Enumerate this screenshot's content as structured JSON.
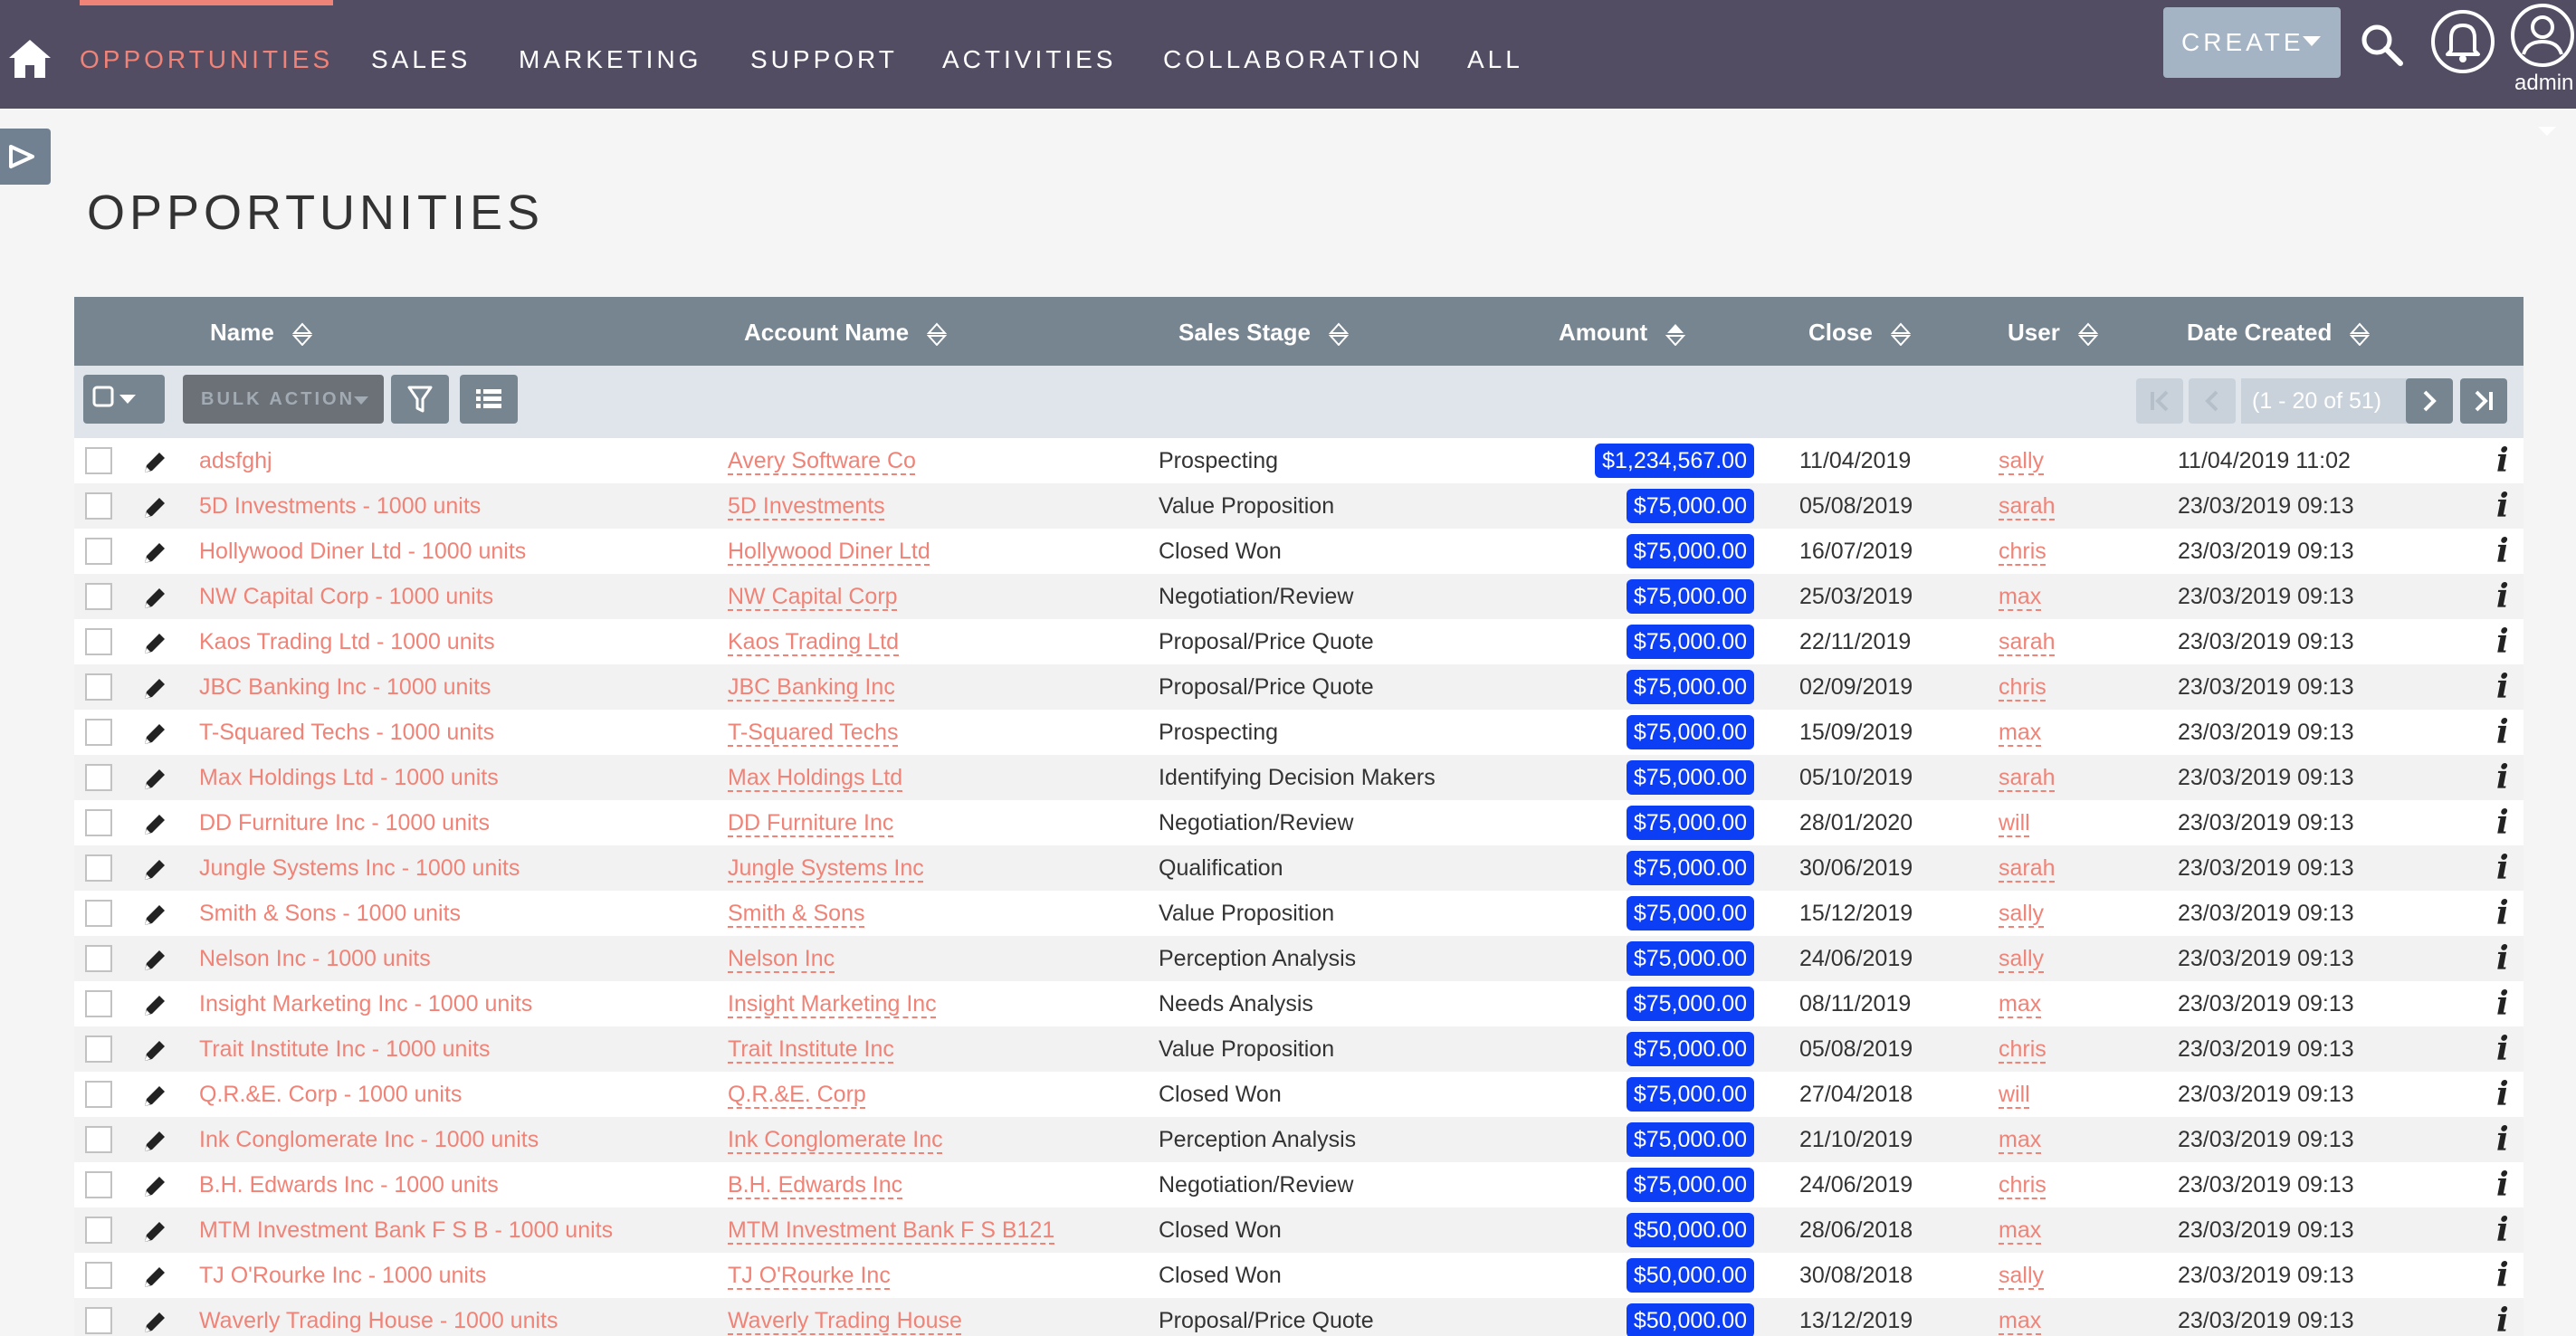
{
  "nav": {
    "tabs": [
      {
        "label": "OPPORTUNITIES",
        "active": true
      },
      {
        "label": "SALES",
        "active": false
      },
      {
        "label": "MARKETING",
        "active": false
      },
      {
        "label": "SUPPORT",
        "active": false
      },
      {
        "label": "ACTIVITIES",
        "active": false
      },
      {
        "label": "COLLABORATION",
        "active": false
      },
      {
        "label": "ALL",
        "active": false
      }
    ],
    "create_label": "CREATE",
    "user_label": "admin"
  },
  "page": {
    "title": "OPPORTUNITIES"
  },
  "table": {
    "columns": [
      "Name",
      "Account Name",
      "Sales Stage",
      "Amount",
      "Close",
      "User",
      "Date Created"
    ],
    "sorted_column": "Amount",
    "bulk_action_label": "BULK ACTION",
    "pagination_label": "(1 - 20 of 51)",
    "rows": [
      {
        "name": "adsfghj",
        "account": "Avery Software Co",
        "stage": "Prospecting",
        "amount": "$1,234,567.00",
        "close": "11/04/2019",
        "user": "sally",
        "created": "11/04/2019 11:02"
      },
      {
        "name": "5D Investments - 1000 units",
        "account": "5D Investments",
        "stage": "Value Proposition",
        "amount": "$75,000.00",
        "close": "05/08/2019",
        "user": "sarah",
        "created": "23/03/2019 09:13"
      },
      {
        "name": "Hollywood Diner Ltd - 1000 units",
        "account": "Hollywood Diner Ltd",
        "stage": "Closed Won",
        "amount": "$75,000.00",
        "close": "16/07/2019",
        "user": "chris",
        "created": "23/03/2019 09:13"
      },
      {
        "name": "NW Capital Corp - 1000 units",
        "account": "NW Capital Corp",
        "stage": "Negotiation/Review",
        "amount": "$75,000.00",
        "close": "25/03/2019",
        "user": "max",
        "created": "23/03/2019 09:13"
      },
      {
        "name": "Kaos Trading Ltd - 1000 units",
        "account": "Kaos Trading Ltd",
        "stage": "Proposal/Price Quote",
        "amount": "$75,000.00",
        "close": "22/11/2019",
        "user": "sarah",
        "created": "23/03/2019 09:13"
      },
      {
        "name": "JBC Banking Inc - 1000 units",
        "account": "JBC Banking Inc",
        "stage": "Proposal/Price Quote",
        "amount": "$75,000.00",
        "close": "02/09/2019",
        "user": "chris",
        "created": "23/03/2019 09:13"
      },
      {
        "name": "T-Squared Techs - 1000 units",
        "account": "T-Squared Techs",
        "stage": "Prospecting",
        "amount": "$75,000.00",
        "close": "15/09/2019",
        "user": "max",
        "created": "23/03/2019 09:13"
      },
      {
        "name": "Max Holdings Ltd - 1000 units",
        "account": "Max Holdings Ltd",
        "stage": "Identifying Decision Makers",
        "amount": "$75,000.00",
        "close": "05/10/2019",
        "user": "sarah",
        "created": "23/03/2019 09:13"
      },
      {
        "name": "DD Furniture Inc - 1000 units",
        "account": "DD Furniture Inc",
        "stage": "Negotiation/Review",
        "amount": "$75,000.00",
        "close": "28/01/2020",
        "user": "will",
        "created": "23/03/2019 09:13"
      },
      {
        "name": "Jungle Systems Inc - 1000 units",
        "account": "Jungle Systems Inc",
        "stage": "Qualification",
        "amount": "$75,000.00",
        "close": "30/06/2019",
        "user": "sarah",
        "created": "23/03/2019 09:13"
      },
      {
        "name": "Smith & Sons - 1000 units",
        "account": "Smith & Sons",
        "stage": "Value Proposition",
        "amount": "$75,000.00",
        "close": "15/12/2019",
        "user": "sally",
        "created": "23/03/2019 09:13"
      },
      {
        "name": "Nelson Inc - 1000 units",
        "account": "Nelson Inc",
        "stage": "Perception Analysis",
        "amount": "$75,000.00",
        "close": "24/06/2019",
        "user": "sally",
        "created": "23/03/2019 09:13"
      },
      {
        "name": "Insight Marketing Inc - 1000 units",
        "account": "Insight Marketing Inc",
        "stage": "Needs Analysis",
        "amount": "$75,000.00",
        "close": "08/11/2019",
        "user": "max",
        "created": "23/03/2019 09:13"
      },
      {
        "name": "Trait Institute Inc - 1000 units",
        "account": "Trait Institute Inc",
        "stage": "Value Proposition",
        "amount": "$75,000.00",
        "close": "05/08/2019",
        "user": "chris",
        "created": "23/03/2019 09:13"
      },
      {
        "name": "Q.R.&E. Corp - 1000 units",
        "account": "Q.R.&E. Corp",
        "stage": "Closed Won",
        "amount": "$75,000.00",
        "close": "27/04/2018",
        "user": "will",
        "created": "23/03/2019 09:13"
      },
      {
        "name": "Ink Conglomerate Inc - 1000 units",
        "account": "Ink Conglomerate Inc",
        "stage": "Perception Analysis",
        "amount": "$75,000.00",
        "close": "21/10/2019",
        "user": "max",
        "created": "23/03/2019 09:13"
      },
      {
        "name": "B.H. Edwards Inc - 1000 units",
        "account": "B.H. Edwards Inc",
        "stage": "Negotiation/Review",
        "amount": "$75,000.00",
        "close": "24/06/2019",
        "user": "chris",
        "created": "23/03/2019 09:13"
      },
      {
        "name": "MTM Investment Bank F S B - 1000 units",
        "account": "MTM Investment Bank F S B121",
        "stage": "Closed Won",
        "amount": "$50,000.00",
        "close": "28/06/2018",
        "user": "max",
        "created": "23/03/2019 09:13"
      },
      {
        "name": "TJ O'Rourke Inc - 1000 units",
        "account": "TJ O'Rourke Inc",
        "stage": "Closed Won",
        "amount": "$50,000.00",
        "close": "30/08/2018",
        "user": "sally",
        "created": "23/03/2019 09:13"
      },
      {
        "name": "Waverly Trading House - 1000 units",
        "account": "Waverly Trading House",
        "stage": "Proposal/Price Quote",
        "amount": "$50,000.00",
        "close": "13/12/2019",
        "user": "max",
        "created": "23/03/2019 09:13"
      }
    ]
  },
  "icons": {
    "home": "home-icon",
    "search": "search-icon",
    "notifications": "bell-icon",
    "user": "user-avatar-icon",
    "sidebar_toggle": "play-icon",
    "filter": "filter-icon",
    "column_chooser": "list-icon",
    "edit": "pencil-icon",
    "info": "info-icon",
    "sort": "sort-icon"
  },
  "colors": {
    "nav_bg": "#534d64",
    "accent": "#f08377",
    "table_header_bg": "#778591",
    "amount_badge": "#0c3ef5",
    "create_bg": "#a5b4c4"
  }
}
